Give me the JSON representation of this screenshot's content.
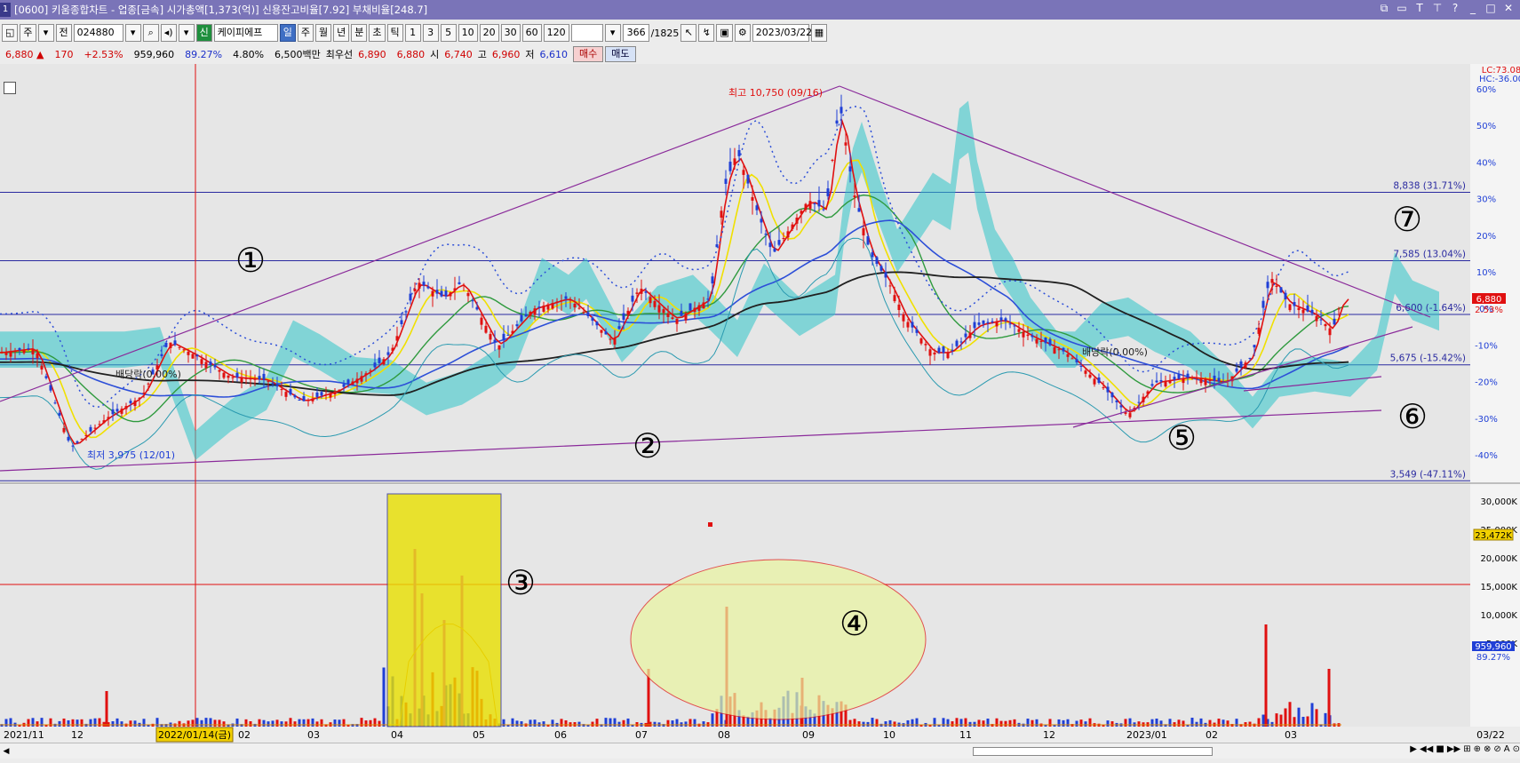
{
  "window": {
    "badge": "1",
    "title": "[0600] 키움종합차트 - 업종[금속] 시가총액[1,373(억)] 신용잔고비율[7.92] 부채비율[248.7]"
  },
  "toolbar": {
    "mode_label": "주",
    "prev_label": "전",
    "code": "024880",
    "sin_label": "신",
    "stock_name": "케이피에프",
    "periods": [
      "일",
      "주",
      "월",
      "년",
      "분",
      "초",
      "틱"
    ],
    "active_period": "일",
    "intervals": [
      "1",
      "3",
      "5",
      "10",
      "20",
      "30",
      "60",
      "120"
    ],
    "count": "366",
    "total": "/1825",
    "date": "2023/03/22"
  },
  "quote": {
    "price": "6,880",
    "change": "170",
    "change_pct": "+2.53%",
    "volume": "959,960",
    "vol_ratio": "89.27%",
    "rate2": "4.80%",
    "amount": "6,500백만",
    "best_label": "최우선",
    "best_ask": "6,890",
    "best_bid": "6,880",
    "open_label": "시",
    "open": "6,740",
    "high_label": "고",
    "high": "6,960",
    "low_label": "저",
    "low": "6,610",
    "buy_label": "매수",
    "sell_label": "매도"
  },
  "chart": {
    "lc_label": "LC:73.08",
    "hc_label": "HC:-36.00",
    "high_annot": "최고 10,750 (09/16)",
    "low_annot": "최저 3,975 (12/01)",
    "div_annot_1": "배당락(0.00%)",
    "div_annot_2": "배당락(0.00%)",
    "price_pct_ticks": [
      "60%",
      "50%",
      "40%",
      "30%",
      "20%",
      "10%",
      "0%",
      "-10%",
      "-20%",
      "-30%",
      "-40%"
    ],
    "hlines": [
      {
        "label": "8,838 (31.71%)",
        "price": 8838
      },
      {
        "label": "7,585 (13.04%)",
        "price": 7585
      },
      {
        "label": "6,600 (-1.64%)",
        "price": 6600
      },
      {
        "label": "5,675 (-15.42%)",
        "price": 5675
      },
      {
        "label": "3,549 (-47.11%)",
        "price": 3549
      }
    ],
    "current_price_tag": "6,880",
    "current_pct_tag": "2.53%",
    "circled_numbers": [
      "①",
      "②",
      "③",
      "④",
      "⑤",
      "⑥",
      "⑦"
    ],
    "volume_ticks": [
      "30,000K",
      "25,000K",
      "20,000K",
      "15,000K",
      "10,000K",
      "5,000K"
    ],
    "volume_line_tag": "23,472K",
    "volume_tag": "959,960",
    "volume_pct_tag": "89.27%",
    "x_labels": [
      "2021/11",
      "12",
      "02",
      "03",
      "04",
      "05",
      "06",
      "07",
      "08",
      "09",
      "10",
      "11",
      "12",
      "2023/01",
      "02",
      "03"
    ],
    "cursor_date": "2022/01/14(금)",
    "right_date": "03/22"
  },
  "colors": {
    "title_bg": "#7a74b8",
    "up": "#e01010",
    "down": "#1f3fd6",
    "cloud": "#2ec4c8",
    "trendline": "#8a2a9a",
    "hline": "#2a2aa0"
  }
}
